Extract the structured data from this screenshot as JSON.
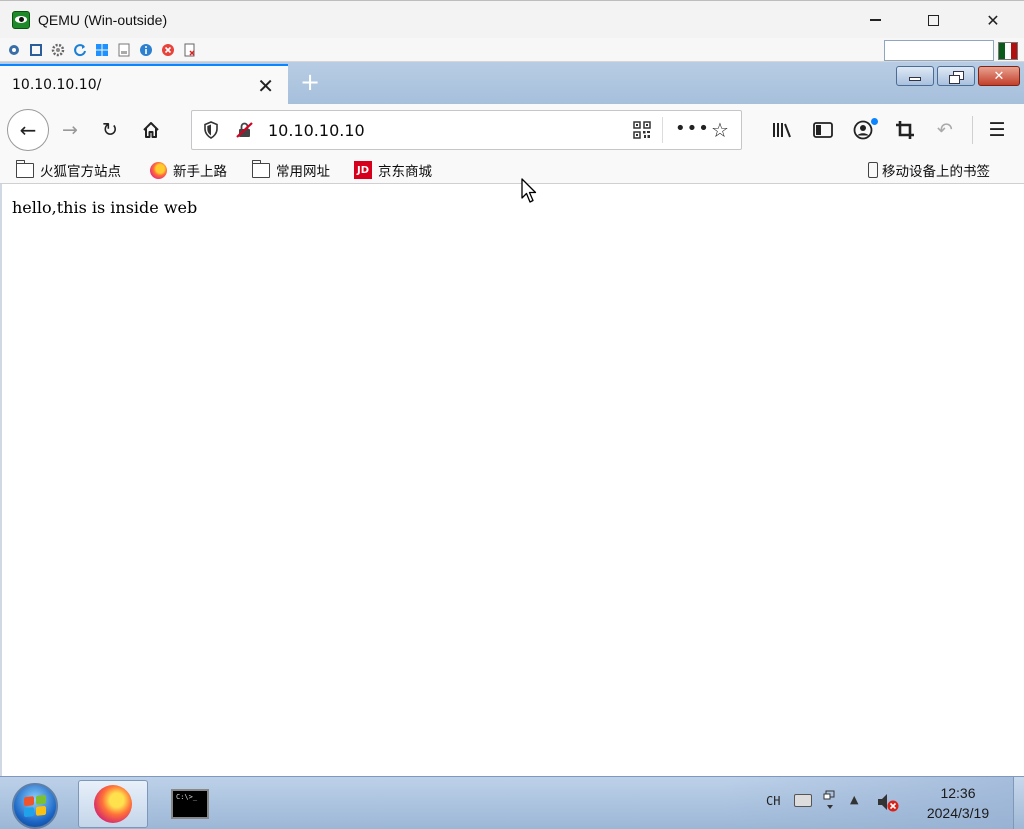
{
  "qemu": {
    "title": "QEMU (Win-outside)",
    "controls": {
      "minimize": "—",
      "maximize": "☐",
      "close": "✕"
    }
  },
  "browser": {
    "tab": {
      "title": "10.10.10.10/",
      "close_glyph": "✕"
    },
    "new_tab_glyph": "+",
    "url": "10.10.10.10",
    "nav": {
      "back_glyph": "←",
      "forward_glyph": "→",
      "reload_glyph": "↻",
      "home_glyph": "⌂",
      "page_actions_glyph": "•••",
      "bookmark_star_glyph": "☆",
      "menu_glyph": "☰",
      "undo_glyph": "↶"
    },
    "bookmarks": [
      {
        "label": "火狐官方站点",
        "icon": "folder-icon"
      },
      {
        "label": "新手上路",
        "icon": "firefox-icon"
      },
      {
        "label": "常用网址",
        "icon": "folder-icon"
      },
      {
        "label": "京东商城",
        "icon": "jd-icon"
      }
    ],
    "jd_icon_text": "JD",
    "mobile_bookmarks": "移动设备上的书签",
    "page_text": "hello,this is inside web"
  },
  "taskbar": {
    "language": "CH",
    "time": "12:36",
    "date": "2024/3/19",
    "cmd_prompt_text": "C:\\>_"
  },
  "colors": {
    "accent": "#0a84ff",
    "tab_bg": "#f9f9fa",
    "jd_red": "#d6001c",
    "guest_background": "#a9c2de"
  }
}
